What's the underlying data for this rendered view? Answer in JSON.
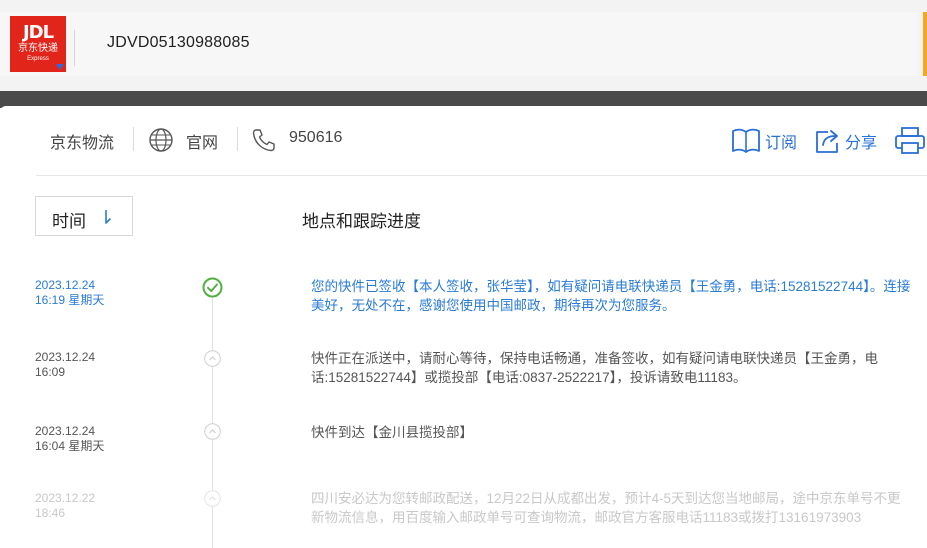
{
  "header": {
    "logo": {
      "line1": "JDL",
      "line2": "京东快递",
      "line3": "Express"
    },
    "tracking_number": "JDVD05130988085"
  },
  "provider": {
    "name": "京东物流",
    "website_label": "官网",
    "phone": "950616"
  },
  "actions": {
    "subscribe": "订阅",
    "share": "分享"
  },
  "table": {
    "time_label": "时间",
    "progress_title": "地点和跟踪进度"
  },
  "events": [
    {
      "date": "2023.12.24",
      "time": "16:19 星期天",
      "text": "您的快件已签收【本人签收，张华莹】，如有疑问请电联快递员【王金勇，电话:15281522744】。连接美好，无处不在，感谢您使用中国邮政，期待再次为您服务。"
    },
    {
      "date": "2023.12.24",
      "time": "16:09",
      "text": "快件正在派送中，请耐心等待，保持电话畅通，准备签收，如有疑问请电联快递员【王金勇，电话:15281522744】或揽投部【电话:0837-2522217】，投诉请致电11183。"
    },
    {
      "date": "2023.12.24",
      "time": "16:04 星期天",
      "text": "快件到达【金川县揽投部】"
    },
    {
      "date": "2023.12.22",
      "time": "18:46",
      "text": "四川安必达为您转邮政配送，12月22日从成都出发，预计4-5天到达您当地邮局，途中京东单号不更新物流信息，用百度输入邮政单号可查询物流，邮政官方客服电话11183或拨打13161973903"
    }
  ],
  "colors": {
    "accent_blue": "#2a7bd5",
    "logo_red": "#e1251b",
    "check_green": "#52b043"
  }
}
